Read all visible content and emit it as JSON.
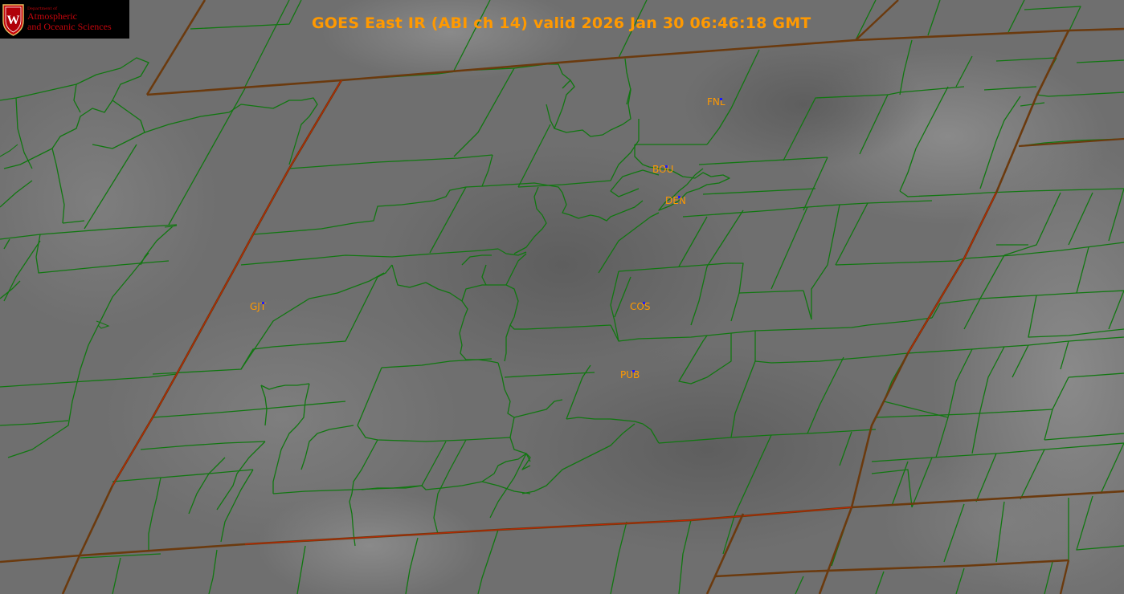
{
  "title": "GOES East IR (ABI ch 14) valid 2026 Jan 30 06:46:18 GMT",
  "logo": {
    "seal_letter": "W",
    "department": "Department of",
    "line1": "Atmospheric",
    "line2": "and Oceanic Sciences"
  },
  "colors": {
    "background_gray": "#707070",
    "county_lines": "#117711",
    "state_lines": "#6b3a0e",
    "state_highlight": "#cc2200",
    "label_text": "#ff9900",
    "station_marker": "#1a1aff",
    "logo_red": "#c5050c"
  },
  "stations": [
    {
      "id": "FNL",
      "label": "FNL"
    },
    {
      "id": "BOU",
      "label": "BOU"
    },
    {
      "id": "DEN",
      "label": "DEN"
    },
    {
      "id": "GJT",
      "label": "GJT"
    },
    {
      "id": "COS",
      "label": "COS"
    },
    {
      "id": "PUB",
      "label": "PUB"
    }
  ]
}
